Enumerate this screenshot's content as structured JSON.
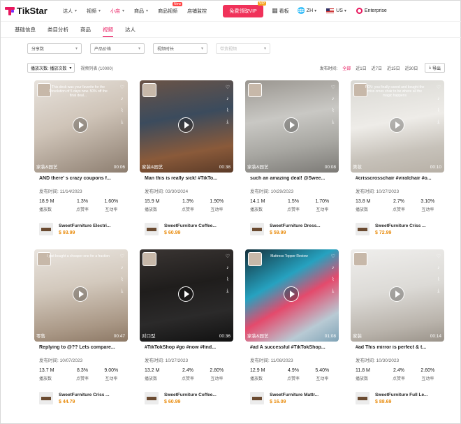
{
  "header": {
    "brand": "TikStar",
    "nav": [
      {
        "label": "达人",
        "chevron": true,
        "active": false
      },
      {
        "label": "视频",
        "chevron": true,
        "active": false
      },
      {
        "label": "小店",
        "chevron": true,
        "active": true
      },
      {
        "label": "商品",
        "chevron": true,
        "active": false
      },
      {
        "label": "商品视频",
        "chevron": false,
        "active": false,
        "badge": "New"
      },
      {
        "label": "店铺监控",
        "chevron": false,
        "active": false
      }
    ],
    "vip_button": "免费领取VIP",
    "vip_tag": "VIP",
    "favorites": "看板",
    "language": "ZH",
    "region": "US",
    "enterprise": "Enterprise"
  },
  "subtabs": {
    "items": [
      "基础信息",
      "类目分析",
      "商品",
      "视频",
      "达人"
    ],
    "active_index": 3
  },
  "filters": [
    {
      "label": "分享数",
      "disabled": false
    },
    {
      "label": "产品价格",
      "disabled": false
    },
    {
      "label": "视频时长",
      "disabled": false
    },
    {
      "label": "带货视频",
      "disabled": true
    }
  ],
  "listbar": {
    "sort_label": "播放次数: 播放次数",
    "count": "视频列表 (10000)",
    "time_label": "发布时间:",
    "time_options": [
      "全部",
      "近1日",
      "近7日",
      "近15日",
      "近30日"
    ],
    "time_active_index": 0,
    "export": "导出"
  },
  "labels": {
    "date": "发布时间:",
    "plays": "播放数",
    "likes": "点赞率",
    "engage": "互动率",
    "currency": "$"
  },
  "colors": {
    "accent": "#e8175d",
    "price": "#e98b0b"
  },
  "cards": [
    {
      "title": "AND there' s crazy coupons f...",
      "category": "家装&园艺",
      "duration": "00:06",
      "date": "11/14/2023",
      "plays": "18.9 M",
      "likes": "1.3%",
      "engage": "1.60%",
      "product": "SweetFurniture Electri...",
      "price": "93.99",
      "overlay": "This desk was your favorite for the Revolution of 5 days now. 50% off the final deal...",
      "bg": "linear-gradient(160deg,#e7e2dc 0%,#cfc4b8 45%,#8d7e70 100%)"
    },
    {
      "title": "Man this is really sick! #TikTo...",
      "category": "家装&园艺",
      "duration": "00:38",
      "date": "03/30/2024",
      "plays": "15.9 M",
      "likes": "1.3%",
      "engage": "1.90%",
      "product": "SweetFurniture Coffee...",
      "price": "60.99",
      "overlay": "",
      "bg": "linear-gradient(170deg,#6a5346 0%,#3b4b5d 40%,#8a5a3a 75%,#5b3b28 100%)"
    },
    {
      "title": "such an amazing deal! @Swee...",
      "category": "家装&园艺",
      "duration": "00:08",
      "date": "10/29/2023",
      "plays": "14.1 M",
      "likes": "1.5%",
      "engage": "1.70%",
      "product": "SweetFurniture Dress...",
      "price": "59.99",
      "overlay": "",
      "bg": "linear-gradient(170deg,#9a9690 0%,#c9c8c4 40%,#a8a7a2 70%,#7c7a76 100%)"
    },
    {
      "title": "#crisscrosschair #viralchair #o...",
      "category": "美妆",
      "duration": "00:10",
      "date": "10/27/2023",
      "plays": "13.8 M",
      "likes": "2.7%",
      "engage": "3.10%",
      "product": "SweetFurniture Criss ...",
      "price": "72.99",
      "overlay": "POV: you finally caved and bought the criss cross chair to be where all the magic happens",
      "bg": "linear-gradient(170deg,#d9d8d3 0%,#eeece8 45%,#c7c2ba 75%,#b7b0a6 100%)"
    },
    {
      "title": "Replying to @?? Lets compare...",
      "category": "零售",
      "duration": "00:47",
      "date": "10/07/2023",
      "plays": "13.7 M",
      "likes": "8.3%",
      "engage": "9.00%",
      "product": "SweetFurniture Criss ...",
      "price": "44.79",
      "overlay": "I just bought a cheaper one for a fraction",
      "bg": "linear-gradient(170deg,#e9e4de 0%,#d3c9bd 40%,#a99785 80%,#8d7966 100%)"
    },
    {
      "title": "#TikTokShop #go #now #find...",
      "category": "对口型",
      "duration": "00:36",
      "date": "10/27/2023",
      "plays": "13.2 M",
      "likes": "2.4%",
      "engage": "2.80%",
      "product": "SweetFurniture Coffee...",
      "price": "60.99",
      "overlay": "",
      "bg": "linear-gradient(170deg,#3a3533 0%,#1f1d1c 40%,#2b2a2a 70%,#111 100%)"
    },
    {
      "title": "#ad A successful #TikTokShop...",
      "category": "家装&园艺",
      "duration": "01:08",
      "date": "11/08/2023",
      "plays": "12.9 M",
      "likes": "4.9%",
      "engage": "5.40%",
      "product": "SweetFurniture Mattr...",
      "price": "16.09",
      "overlay": "Mattress Topper Review",
      "bg": "linear-gradient(150deg,#142f3a 0%,#26a2c0 35%,#e44a6c 55%,#b8cad4 80%,#7fa3b6 100%)"
    },
    {
      "title": "#ad This mirror is perfect & t...",
      "category": "家装",
      "duration": "00:14",
      "date": "10/30/2023",
      "plays": "11.8 M",
      "likes": "2.4%",
      "engage": "2.60%",
      "product": "SweetFurniture Full Le...",
      "price": "88.69",
      "overlay": "",
      "bg": "linear-gradient(170deg,#efeeec 0%,#dcdad6 45%,#b9b3ab 80%,#9a938a 100%)"
    }
  ]
}
